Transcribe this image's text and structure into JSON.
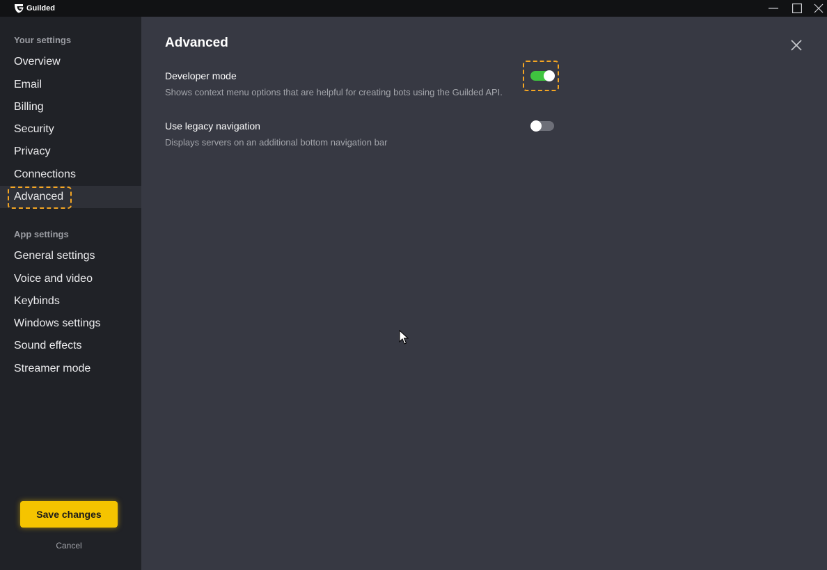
{
  "titlebar": {
    "app_name": "Guilded",
    "minimize_icon": "minimize-icon",
    "maximize_icon": "maximize-icon",
    "close_icon": "close-icon"
  },
  "sidebar": {
    "your_settings_heading": "Your settings",
    "your_settings_items": [
      {
        "label": "Overview"
      },
      {
        "label": "Email"
      },
      {
        "label": "Billing"
      },
      {
        "label": "Security"
      },
      {
        "label": "Privacy"
      },
      {
        "label": "Connections"
      },
      {
        "label": "Advanced",
        "active": true
      }
    ],
    "app_settings_heading": "App settings",
    "app_settings_items": [
      {
        "label": "General settings"
      },
      {
        "label": "Voice and video"
      },
      {
        "label": "Keybinds"
      },
      {
        "label": "Windows settings"
      },
      {
        "label": "Sound effects"
      },
      {
        "label": "Streamer mode"
      }
    ],
    "save_label": "Save changes",
    "cancel_label": "Cancel"
  },
  "main": {
    "title": "Advanced",
    "close_icon": "close-icon",
    "settings": [
      {
        "title": "Developer mode",
        "description": "Shows context menu options that are helpful for creating bots using the Guilded API.",
        "enabled": true
      },
      {
        "title": "Use legacy navigation",
        "description": "Displays servers on an additional bottom navigation bar",
        "enabled": false
      }
    ]
  },
  "colors": {
    "accent": "#f5c400",
    "highlight": "#f5a623",
    "toggle_on": "#3fc43f",
    "toggle_off": "#6d6f78",
    "sidebar_bg": "#202227",
    "main_bg": "#373943"
  }
}
